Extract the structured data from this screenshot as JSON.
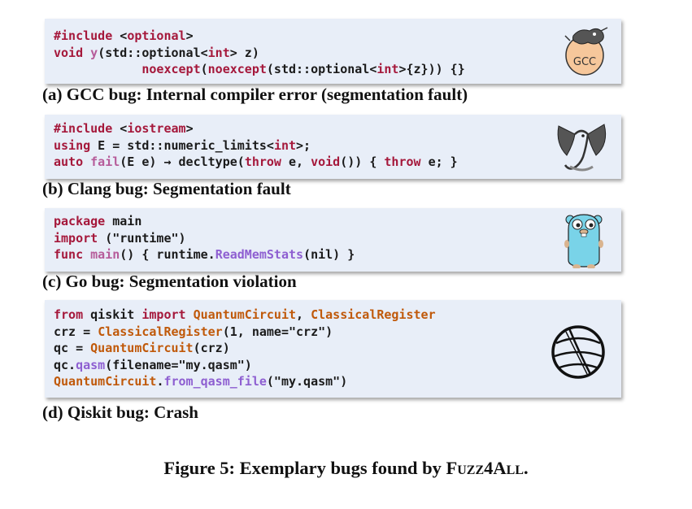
{
  "panels": [
    {
      "id": "a",
      "logo": "gcc-logo",
      "logo_text": "GCC",
      "lines": [
        [
          [
            "k",
            "#include"
          ],
          [
            "p",
            " <"
          ],
          [
            "k",
            "optional"
          ],
          [
            "p",
            ">"
          ]
        ],
        [
          [
            "k",
            "void"
          ],
          [
            "p",
            " "
          ],
          [
            "f",
            "y"
          ],
          [
            "p",
            "(std::optional<"
          ],
          [
            "k",
            "int"
          ],
          [
            "p",
            "> z)"
          ]
        ],
        [
          [
            "p",
            "            "
          ],
          [
            "k",
            "noexcept"
          ],
          [
            "p",
            "("
          ],
          [
            "k",
            "noexcept"
          ],
          [
            "p",
            "(std::optional<"
          ],
          [
            "k",
            "int"
          ],
          [
            "p",
            ">{z})) {}"
          ]
        ]
      ],
      "caption": "(a) GCC bug: Internal compiler error (segmentation fault)"
    },
    {
      "id": "b",
      "logo": "clang-dragon-logo",
      "lines": [
        [
          [
            "k",
            "#include"
          ],
          [
            "p",
            " <"
          ],
          [
            "k",
            "iostream"
          ],
          [
            "p",
            ">"
          ]
        ],
        [
          [
            "k",
            "using"
          ],
          [
            "p",
            " E = std::numeric_limits<"
          ],
          [
            "k",
            "int"
          ],
          [
            "p",
            ">;"
          ]
        ],
        [
          [
            "k",
            "auto"
          ],
          [
            "p",
            " "
          ],
          [
            "f",
            "fail"
          ],
          [
            "p",
            "(E e) → decltype("
          ],
          [
            "k",
            "throw"
          ],
          [
            "p",
            " e, "
          ],
          [
            "k",
            "void"
          ],
          [
            "p",
            "()) { "
          ],
          [
            "k",
            "throw"
          ],
          [
            "p",
            " e; }"
          ]
        ]
      ],
      "caption": "(b) Clang bug: Segmentation fault"
    },
    {
      "id": "c",
      "logo": "go-gopher-logo",
      "lines": [
        [
          [
            "k",
            "package"
          ],
          [
            "p",
            " main"
          ]
        ],
        [
          [
            "k",
            "import"
          ],
          [
            "p",
            " (\"runtime\")"
          ]
        ],
        [
          [
            "k",
            "func"
          ],
          [
            "p",
            " "
          ],
          [
            "f",
            "main"
          ],
          [
            "p",
            "() { runtime."
          ],
          [
            "fn",
            "ReadMemStats"
          ],
          [
            "p",
            "(nil) }"
          ]
        ]
      ],
      "caption": "(c) Go bug: Segmentation violation"
    },
    {
      "id": "d",
      "logo": "qiskit-logo",
      "lines": [
        [
          [
            "k",
            "from"
          ],
          [
            "p",
            " qiskit "
          ],
          [
            "k",
            "import"
          ],
          [
            "p",
            " "
          ],
          [
            "c",
            "QuantumCircuit"
          ],
          [
            "p",
            ", "
          ],
          [
            "c",
            "ClassicalRegister"
          ]
        ],
        [
          [
            "p",
            "crz = "
          ],
          [
            "c",
            "ClassicalRegister"
          ],
          [
            "p",
            "(1, name=\"crz\")"
          ]
        ],
        [
          [
            "p",
            "qc = "
          ],
          [
            "c",
            "QuantumCircuit"
          ],
          [
            "p",
            "(crz)"
          ]
        ],
        [
          [
            "p",
            "qc."
          ],
          [
            "fn",
            "qasm"
          ],
          [
            "p",
            "(filename=\"my.qasm\")"
          ]
        ],
        [
          [
            "c",
            "QuantumCircuit"
          ],
          [
            "p",
            "."
          ],
          [
            "fn",
            "from_qasm_file"
          ],
          [
            "p",
            "(\"my.qasm\")"
          ]
        ]
      ],
      "caption": "(d) Qiskit bug: Crash"
    }
  ],
  "figure_caption": {
    "prefix": "Figure 5: Exemplary bugs found by ",
    "tool_name": "Fuzz4All",
    "suffix": "."
  }
}
